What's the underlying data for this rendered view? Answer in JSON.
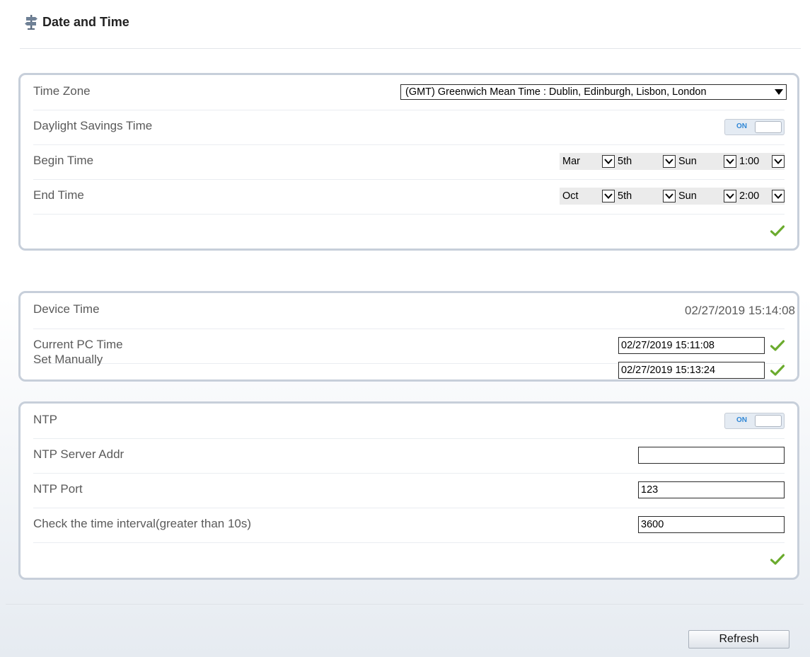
{
  "header": {
    "title": "Date and Time",
    "icon": "signpost-icon"
  },
  "dst_panel": {
    "time_zone": {
      "label": "Time Zone",
      "value": "(GMT) Greenwich Mean Time : Dublin, Edinburgh, Lisbon, London"
    },
    "daylight_savings": {
      "label": "Daylight Savings Time",
      "toggle": "ON"
    },
    "begin_time": {
      "label": "Begin Time",
      "month": "Mar",
      "week": "5th",
      "day": "Sun",
      "hour": "1:00"
    },
    "end_time": {
      "label": "End Time",
      "month": "Oct",
      "week": "5th",
      "day": "Sun",
      "hour": "2:00"
    }
  },
  "time_panel": {
    "device_time": {
      "label": "Device Time",
      "value": "02/27/2019 15:14:08"
    },
    "pc_time": {
      "label": "Current PC Time",
      "value": "02/27/2019 15:11:08"
    },
    "manual": {
      "label": "Set Manually",
      "value": "02/27/2019 15:13:24"
    }
  },
  "ntp_panel": {
    "ntp": {
      "label": "NTP",
      "toggle": "ON"
    },
    "server": {
      "label": "NTP Server Addr",
      "value": ""
    },
    "port": {
      "label": "NTP Port",
      "value": "123"
    },
    "interval": {
      "label": "Check the time interval(greater than 10s)",
      "value": "3600"
    }
  },
  "refresh_label": "Refresh",
  "colors": {
    "check": "#6bab2e",
    "toggle_text": "#2f87d6",
    "panel_border": "#c7cfda"
  }
}
